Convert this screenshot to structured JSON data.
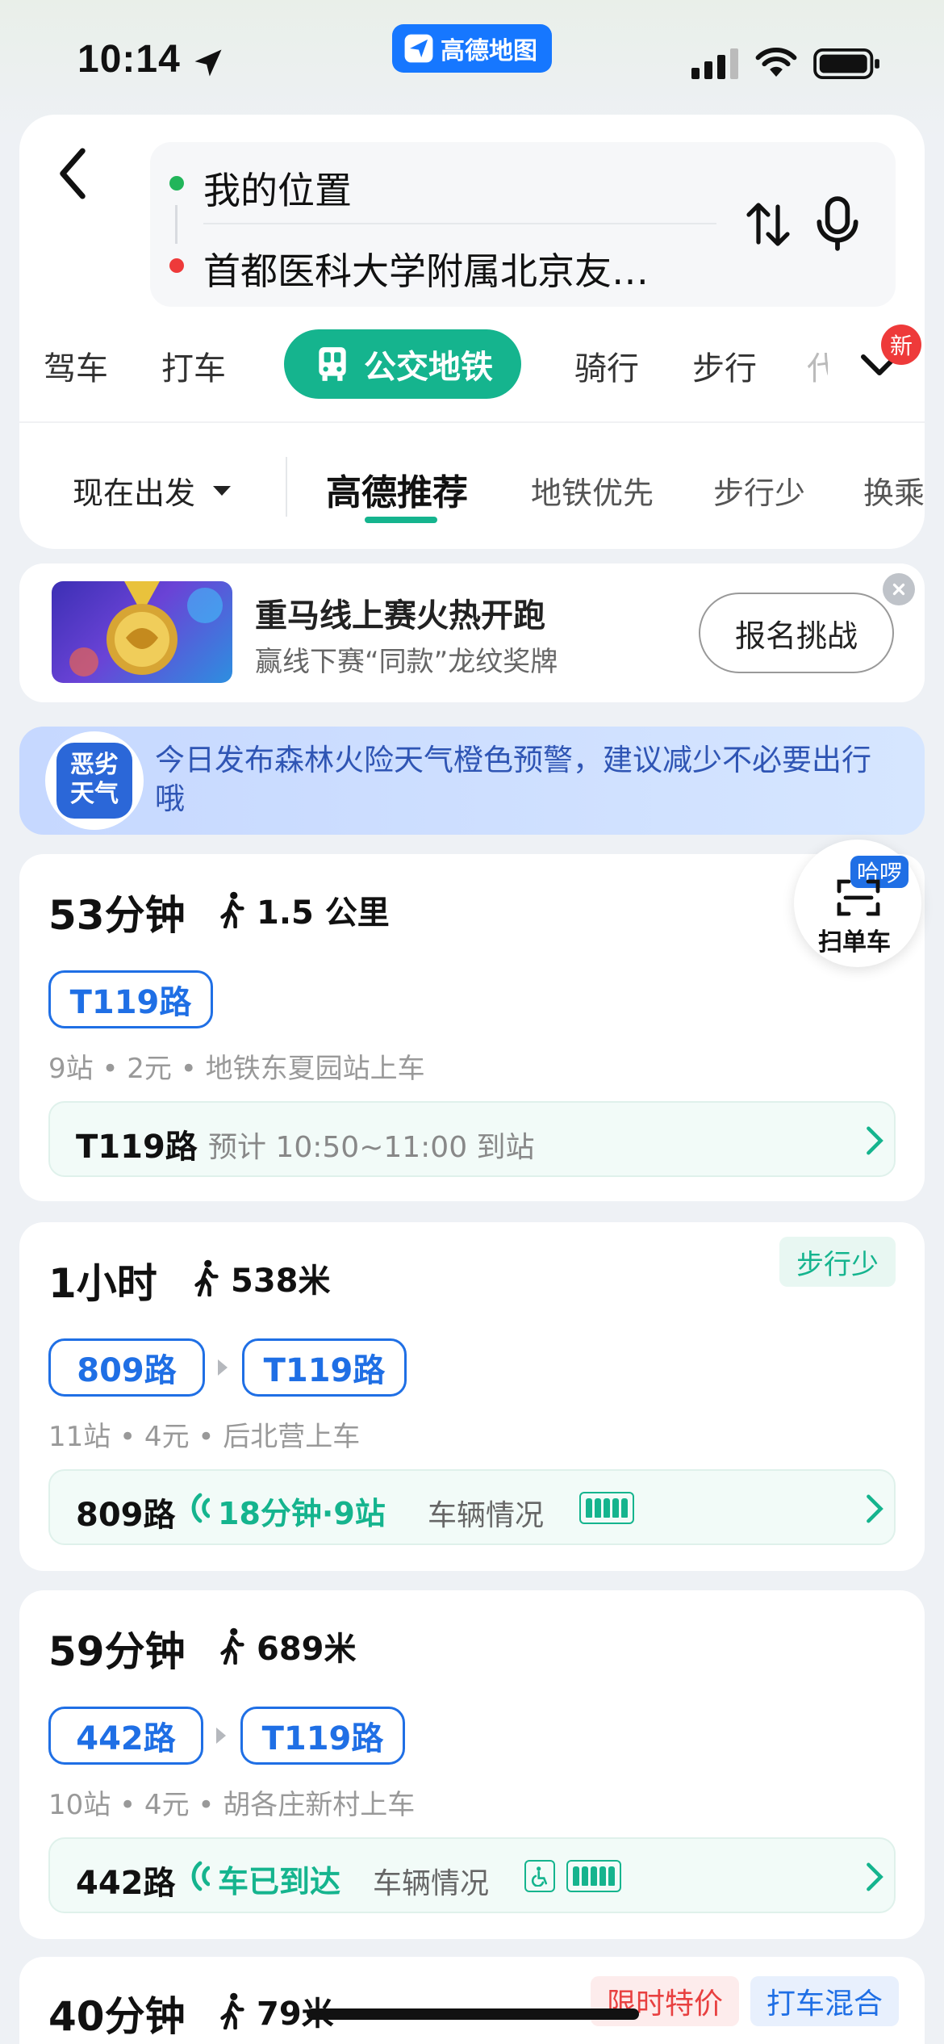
{
  "status_bar": {
    "time": "10:14",
    "app_name": "高德地图"
  },
  "route": {
    "from": "我的位置",
    "to": "首都医科大学附属北京友…"
  },
  "modes": {
    "drive": "驾车",
    "taxi": "打车",
    "transit": "公交地铁",
    "ride": "骑行",
    "walk": "步行",
    "more_partial": "代",
    "new_badge": "新"
  },
  "filters": {
    "depart": "现在出发",
    "recommend": "高德推荐",
    "subway_first": "地铁优先",
    "less_walk": "步行少",
    "transfer_partial": "换乘"
  },
  "promo": {
    "title": "重马线上赛火热开跑",
    "subtitle": "赢线下赛“同款”龙纹奖牌",
    "button": "报名挑战"
  },
  "weather": {
    "icon_line1": "恶劣",
    "icon_line2": "天气",
    "text": "今日发布森林火险天气橙色预警，建议减少不必要出行哦"
  },
  "scan": {
    "badge": "哈啰",
    "label": "扫单车"
  },
  "routes": [
    {
      "duration": "53分钟",
      "walk": "1.5 公里",
      "lines": [
        "T119路"
      ],
      "meta": "9站 • 2元 • 地铁东夏园站上车",
      "eta_line": "T119路",
      "eta_note": "预计 10:50~11:00 到站"
    },
    {
      "duration": "1小时",
      "walk": "538米",
      "tag": "步行少",
      "lines": [
        "809路",
        "T119路"
      ],
      "meta": "11站 • 4元 • 后北营上车",
      "eta_line": "809路",
      "eta_live": "18分钟·9站",
      "vehicle_label": "车辆情况"
    },
    {
      "duration": "59分钟",
      "walk": "689米",
      "lines": [
        "442路",
        "T119路"
      ],
      "meta": "10站 • 4元 • 胡各庄新村上车",
      "eta_line": "442路",
      "eta_live": "车已到达",
      "vehicle_label": "车辆情况"
    },
    {
      "duration": "40分钟",
      "walk": "79米",
      "tags": [
        "限时特价",
        "打车混合"
      ]
    }
  ],
  "colors": {
    "accent": "#15b48e",
    "blue": "#1f6fe5",
    "red": "#ee3a3a"
  }
}
